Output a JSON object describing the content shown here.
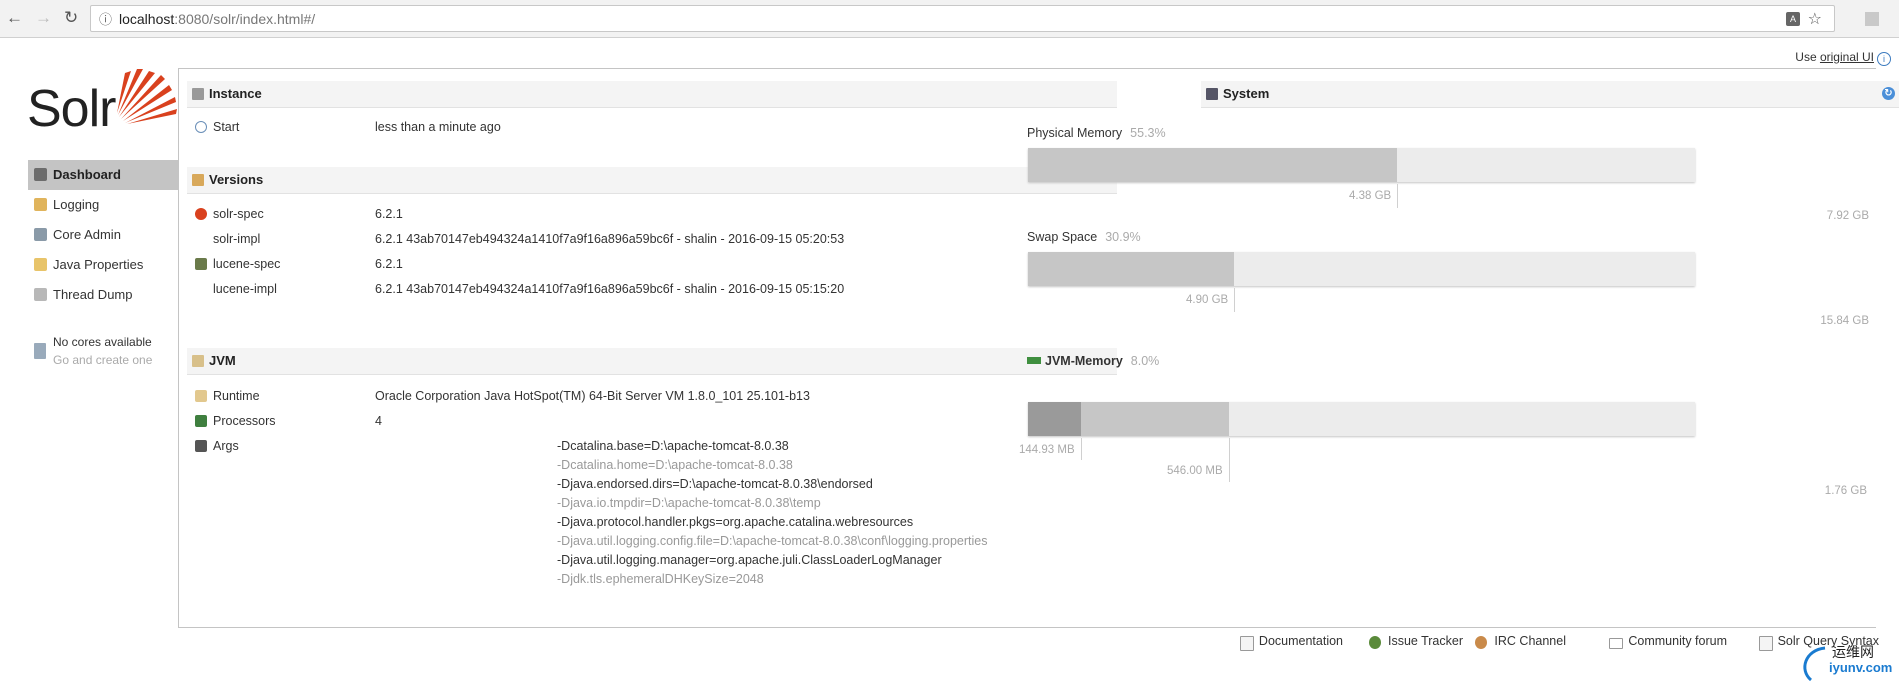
{
  "browser": {
    "url_host": "localhost",
    "url_rest": ":8080/solr/index.html#/"
  },
  "top": {
    "use_text": "Use",
    "original_ui": "original UI"
  },
  "logo": {
    "word": "Solr"
  },
  "sidebar": {
    "items": [
      {
        "label": "Dashboard",
        "icon": "dashboard-icon",
        "active": true
      },
      {
        "label": "Logging",
        "icon": "logging-icon"
      },
      {
        "label": "Core Admin",
        "icon": "core-admin-icon"
      },
      {
        "label": "Java Properties",
        "icon": "java-properties-icon"
      },
      {
        "label": "Thread Dump",
        "icon": "thread-dump-icon"
      }
    ],
    "no_cores": "No cores available",
    "create_one": "Go and create one"
  },
  "instance": {
    "title": "Instance",
    "start_label": "Start",
    "start_value": "less than a minute ago"
  },
  "versions": {
    "title": "Versions",
    "rows": [
      {
        "key": "solr-spec",
        "value": "6.2.1"
      },
      {
        "key": "solr-impl",
        "value": "6.2.1 43ab70147eb494324a1410f7a9f16a896a59bc6f - shalin - 2016-09-15 05:20:53"
      },
      {
        "key": "lucene-spec",
        "value": "6.2.1"
      },
      {
        "key": "lucene-impl",
        "value": "6.2.1 43ab70147eb494324a1410f7a9f16a896a59bc6f - shalin - 2016-09-15 05:15:20"
      }
    ]
  },
  "jvm": {
    "title": "JVM",
    "runtime_label": "Runtime",
    "runtime_value": "Oracle Corporation Java HotSpot(TM) 64-Bit Server VM 1.8.0_101 25.101-b13",
    "processors_label": "Processors",
    "processors_value": "4",
    "args_label": "Args",
    "args": [
      "-Dcatalina.base=D:\\apache-tomcat-8.0.38",
      "-Dcatalina.home=D:\\apache-tomcat-8.0.38",
      "-Djava.endorsed.dirs=D:\\apache-tomcat-8.0.38\\endorsed",
      "-Djava.io.tmpdir=D:\\apache-tomcat-8.0.38\\temp",
      "-Djava.protocol.handler.pkgs=org.apache.catalina.webresources",
      "-Djava.util.logging.config.file=D:\\apache-tomcat-8.0.38\\conf\\logging.properties",
      "-Djava.util.logging.manager=org.apache.juli.ClassLoaderLogManager",
      "-Djdk.tls.ephemeralDHKeySize=2048"
    ]
  },
  "system": {
    "title": "System",
    "physical": {
      "label": "Physical Memory",
      "pct": "55.3%",
      "used": "4.38 GB",
      "total": "7.92 GB",
      "fraction": 0.553
    },
    "swap": {
      "label": "Swap Space",
      "pct": "30.9%",
      "used": "4.90 GB",
      "total": "15.84 GB",
      "fraction": 0.309
    },
    "jvm_memory": {
      "label": "JVM-Memory",
      "pct": "8.0%",
      "used": "144.93 MB",
      "committed": "546.00 MB",
      "max": "1.76 GB",
      "fraction_used": 0.08,
      "fraction_committed": 0.302
    }
  },
  "footer": {
    "links": [
      {
        "label": "Documentation",
        "icon": "documentation-icon"
      },
      {
        "label": "Issue Tracker",
        "icon": "bug-icon"
      },
      {
        "label": "IRC Channel",
        "icon": "irc-icon"
      },
      {
        "label": "Community forum",
        "icon": "mail-icon"
      },
      {
        "label": "Solr Query Syntax",
        "icon": "syntax-icon"
      }
    ]
  },
  "watermark": {
    "line1": "运维网",
    "line2": "iyunv.com"
  },
  "colors": {
    "solr_red": "#d9411e",
    "accent_blue": "#3c7bbf",
    "bar_fill": "#c6c6c6",
    "bar_bg": "#ececec"
  }
}
